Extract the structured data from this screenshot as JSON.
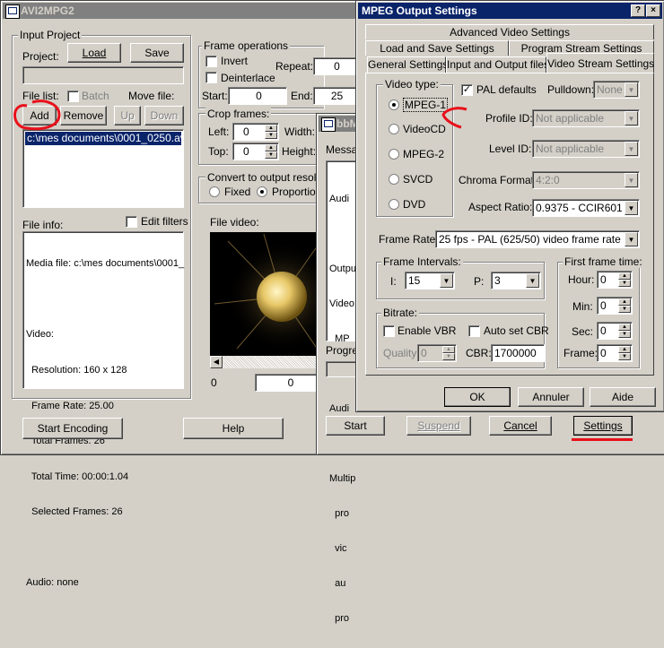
{
  "main": {
    "title": "AVI2MPG2",
    "input_project_group": "Input Project",
    "project_label": "Project:",
    "load_button": "Load",
    "save_button": "Save",
    "file_list_label": "File list:",
    "batch_label": "Batch",
    "move_file_label": "Move file:",
    "add_button": "Add",
    "remove_button": "Remove",
    "up_button": "Up",
    "down_button": "Down",
    "file_list_items": [
      "c:\\mes documents\\0001_0250.avi"
    ],
    "file_info_label": "File info:",
    "edit_filters_label": "Edit filters",
    "file_info_lines": [
      "Media file: c:\\mes documents\\0001_",
      "",
      "Video:",
      "  Resolution: 160 x 128",
      "  Frame Rate: 25.00",
      "  Total Frames: 26",
      "  Total Time: 00:00:1.04",
      "  Selected Frames: 26",
      "",
      "Audio: none"
    ],
    "frame_ops_group": "Frame operations",
    "invert_label": "Invert",
    "repeat_label": "Repeat:",
    "repeat_value": "0",
    "deinterlace_label": "Deinterlace",
    "start_label": "Start:",
    "start_value": "0",
    "end_label": "End:",
    "end_value": "25",
    "crop_group": "Crop frames:",
    "left_label": "Left:",
    "left_value": "0",
    "width_label": "Width:",
    "top_label": "Top:",
    "top_value": "0",
    "height_label": "Height:",
    "convert_group": "Convert to output resolutio",
    "fixed_label": "Fixed",
    "proportional_label": "Proportiona",
    "file_video_label": "File video:",
    "position_value": "0",
    "position_field_value": "0",
    "start_encoding_button": "Start Encoding",
    "help_button": "Help"
  },
  "middle": {
    "title_fragment": "bbM",
    "messages_label": "Messag",
    "message_lines": [
      "Audi",
      "",
      "Output",
      "Video",
      "  MP",
      "",
      "Audi",
      "",
      "Multip",
      "  pro",
      "  vic",
      "  au",
      "  pro"
    ],
    "progress_label": "Progres",
    "start_button": "Start",
    "suspend_button": "Suspend",
    "cancel_button": "Cancel",
    "settings_button": "Settings"
  },
  "dialog": {
    "title": "MPEG Output Settings",
    "help_glyph": "?",
    "close_glyph": "×",
    "tabs_row1": [
      "Advanced Video Settings"
    ],
    "tabs_row2": [
      "Load and Save Settings",
      "Program Stream Settings"
    ],
    "tabs_row3": [
      "General Settings",
      "Input and Output files",
      "Video Stream Settings"
    ],
    "video_type_group": "Video type:",
    "video_types": [
      "MPEG-1",
      "VideoCD",
      "MPEG-2",
      "SVCD",
      "DVD"
    ],
    "pal_defaults_label": "PAL defaults",
    "pulldown_label": "Pulldown:",
    "pulldown_value": "None",
    "profile_id_label": "Profile ID:",
    "profile_id_value": "Not applicable",
    "level_id_label": "Level ID:",
    "level_id_value": "Not applicable",
    "chroma_format_label": "Chroma Format:",
    "chroma_format_value": "4:2:0",
    "aspect_ratio_label": "Aspect Ratio:",
    "aspect_ratio_value": "0.9375 - CCIR601 62",
    "frame_rate_label": "Frame Rate:",
    "frame_rate_value": "25 fps - PAL (625/50) video frame rate",
    "frame_intervals_group": "Frame Intervals:",
    "i_label": "I:",
    "i_value": "15",
    "p_label": "P:",
    "p_value": "3",
    "bitrate_group": "Bitrate:",
    "enable_vbr_label": "Enable VBR",
    "auto_cbr_label": "Auto set CBR",
    "quality_label": "Quality:",
    "quality_value": "0",
    "cbr_label": "CBR:",
    "cbr_value": "1700000",
    "first_frame_group": "First frame time:",
    "hour_label": "Hour:",
    "hour_value": "0",
    "min_label": "Min:",
    "min_value": "0",
    "sec_label": "Sec:",
    "sec_value": "0",
    "frame_label": "Frame:",
    "frame_value": "0",
    "ok_button": "OK",
    "cancel_button": "Annuler",
    "help_button": "Aide"
  },
  "colors": {
    "annotation_red": "#e8101a",
    "selection_blue": "#0a246a",
    "face": "#d4d0c8"
  }
}
